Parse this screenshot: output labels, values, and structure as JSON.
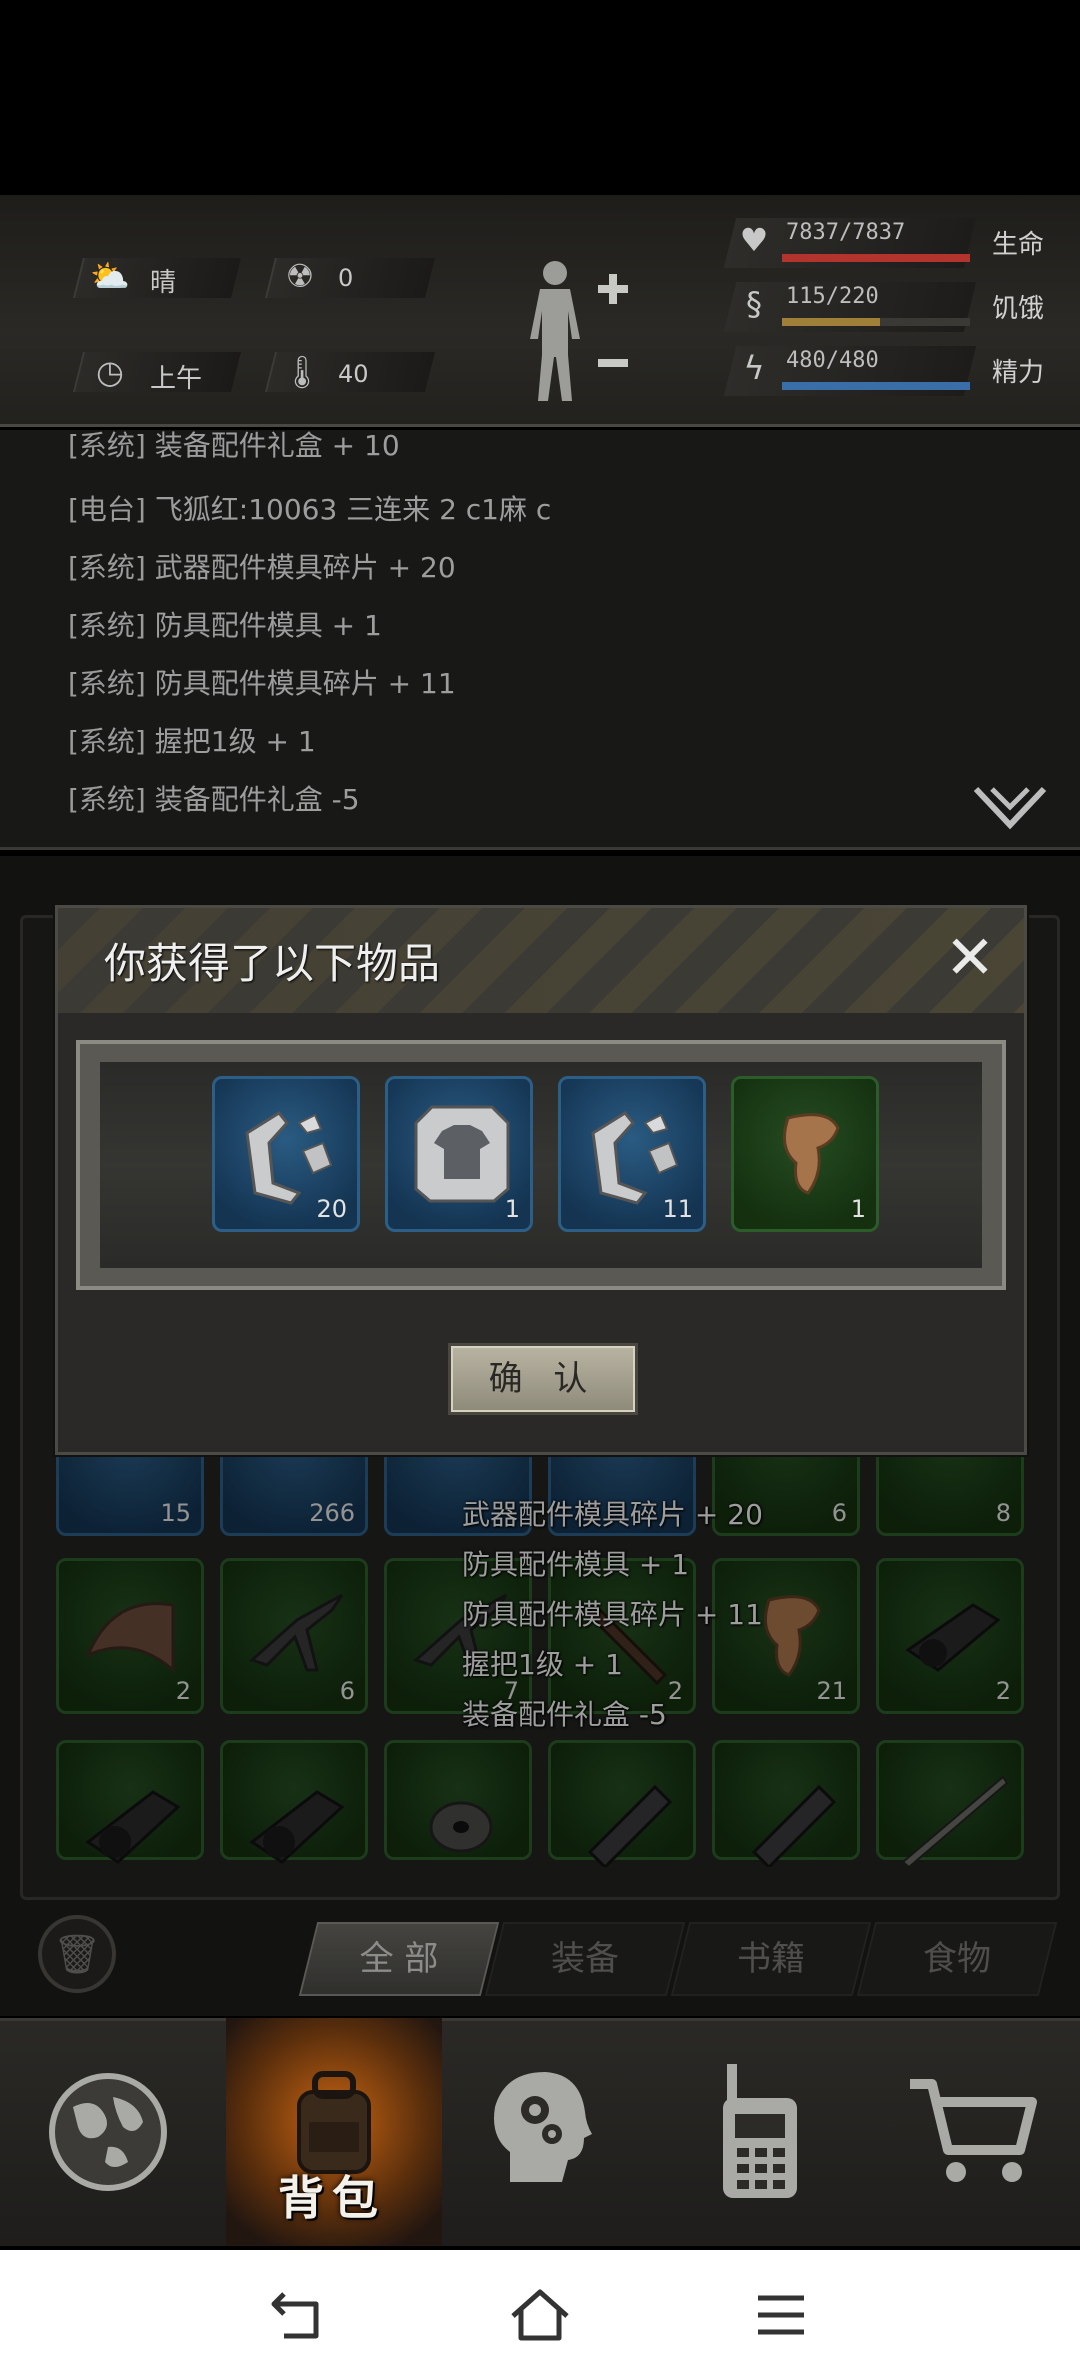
{
  "status": {
    "weather": "晴",
    "radiation": "0",
    "time_of_day": "上午",
    "temperature": "40",
    "stats": [
      {
        "value": "7837/7837",
        "label": "生命",
        "fraction": 1.0,
        "color": "#b2342c",
        "icon": "heart-pulse-icon"
      },
      {
        "value": "115/220",
        "label": "饥饿",
        "fraction": 0.52,
        "color": "#a08038",
        "icon": "stomach-icon"
      },
      {
        "value": "480/480",
        "label": "精力",
        "fraction": 1.0,
        "color": "#3a6ea8",
        "icon": "lightning-icon"
      }
    ]
  },
  "log": [
    {
      "tag": "[系统]",
      "text": " 装备配件礼盒 + 10"
    },
    {
      "tag": "[电台]",
      "text": " 飞狐红:10063 三连来 2 c1麻 c"
    },
    {
      "tag": "[系统]",
      "text": " 武器配件模具碎片 + 20"
    },
    {
      "tag": "[系统]",
      "text": " 防具配件模具 + 1"
    },
    {
      "tag": "[系统]",
      "text": " 防具配件模具碎片 + 11"
    },
    {
      "tag": "[系统]",
      "text": " 握把1级 + 1"
    },
    {
      "tag": "[系统]",
      "text": " 装备配件礼盒 -5"
    }
  ],
  "inventory": {
    "row1": [
      "15",
      "266",
      "",
      "",
      "6",
      "8"
    ],
    "row2": [
      "2",
      "6",
      "7",
      "2",
      "21",
      "2"
    ],
    "row3": [
      "",
      "",
      "",
      "",
      "",
      ""
    ]
  },
  "float_messages": [
    "武器配件模具碎片 + 20",
    "防具配件模具 + 1",
    "防具配件模具碎片 + 11",
    "握把1级 + 1",
    "装备配件礼盒 -5"
  ],
  "tabs": [
    "全 部",
    "装备",
    "书籍",
    "食物"
  ],
  "modal": {
    "title": "你获得了以下物品",
    "confirm_label": "确 认",
    "rewards": [
      {
        "count": "20",
        "icon": "weapon-mold-fragment-icon"
      },
      {
        "count": "1",
        "icon": "armor-mold-icon"
      },
      {
        "count": "11",
        "icon": "armor-mold-fragment-icon"
      },
      {
        "count": "1",
        "icon": "grip-icon"
      }
    ]
  },
  "nav": {
    "backpack_label": "背包"
  }
}
